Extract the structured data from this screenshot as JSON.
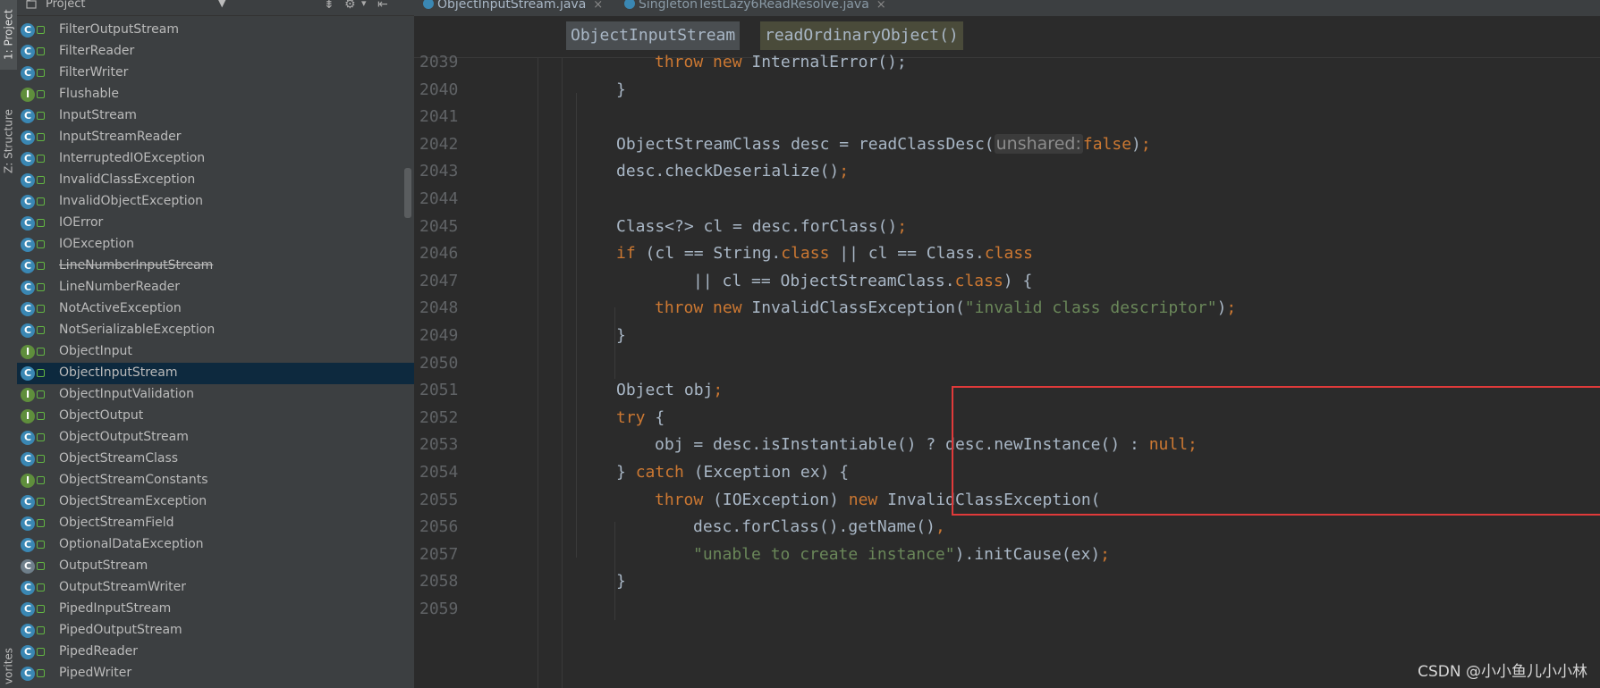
{
  "side_strip": {
    "project_tab": "1: Project",
    "structure_tab": "Z: Structure",
    "favorites_tab": "vorites"
  },
  "project_panel": {
    "title": "Project",
    "selected": "ObjectInputStream",
    "items": [
      {
        "name": "FilterOutputStream",
        "kind": "class"
      },
      {
        "name": "FilterReader",
        "kind": "class"
      },
      {
        "name": "FilterWriter",
        "kind": "class"
      },
      {
        "name": "Flushable",
        "kind": "interface"
      },
      {
        "name": "InputStream",
        "kind": "class"
      },
      {
        "name": "InputStreamReader",
        "kind": "class"
      },
      {
        "name": "InterruptedIOException",
        "kind": "class"
      },
      {
        "name": "InvalidClassException",
        "kind": "class"
      },
      {
        "name": "InvalidObjectException",
        "kind": "class"
      },
      {
        "name": "IOError",
        "kind": "class"
      },
      {
        "name": "IOException",
        "kind": "class"
      },
      {
        "name": "LineNumberInputStream",
        "kind": "class",
        "deprecated": true
      },
      {
        "name": "LineNumberReader",
        "kind": "class"
      },
      {
        "name": "NotActiveException",
        "kind": "class"
      },
      {
        "name": "NotSerializableException",
        "kind": "class"
      },
      {
        "name": "ObjectInput",
        "kind": "interface"
      },
      {
        "name": "ObjectInputStream",
        "kind": "class"
      },
      {
        "name": "ObjectInputValidation",
        "kind": "interface"
      },
      {
        "name": "ObjectOutput",
        "kind": "interface"
      },
      {
        "name": "ObjectOutputStream",
        "kind": "class"
      },
      {
        "name": "ObjectStreamClass",
        "kind": "class"
      },
      {
        "name": "ObjectStreamConstants",
        "kind": "interface"
      },
      {
        "name": "ObjectStreamException",
        "kind": "class"
      },
      {
        "name": "ObjectStreamField",
        "kind": "class"
      },
      {
        "name": "OptionalDataException",
        "kind": "class"
      },
      {
        "name": "OutputStream",
        "kind": "abstract"
      },
      {
        "name": "OutputStreamWriter",
        "kind": "class"
      },
      {
        "name": "PipedInputStream",
        "kind": "class"
      },
      {
        "name": "PipedOutputStream",
        "kind": "class"
      },
      {
        "name": "PipedReader",
        "kind": "class"
      },
      {
        "name": "PipedWriter",
        "kind": "class"
      }
    ]
  },
  "editor": {
    "tabs": [
      {
        "label": "ObjectInputStream.java",
        "active": true
      },
      {
        "label": "SingletonTestLazy6ReadResolve.java",
        "active": false
      }
    ],
    "breadcrumb": [
      "ObjectInputStream",
      "readOrdinaryObject()"
    ],
    "lines": [
      {
        "no": "2039",
        "indent": 2,
        "parts": [
          {
            "t": "throw new ",
            "c": "kw"
          },
          {
            "t": "InternalError();"
          }
        ]
      },
      {
        "no": "2040",
        "indent": 1,
        "parts": [
          {
            "t": "}"
          }
        ]
      },
      {
        "no": "2041",
        "indent": 0,
        "parts": []
      },
      {
        "no": "2042",
        "indent": 1,
        "parts": [
          {
            "t": "ObjectStreamClass desc = readClassDesc("
          },
          {
            "t": "unshared:",
            "c": "hint"
          },
          {
            "t": "false",
            "c": "kw"
          },
          {
            "t": ")"
          },
          {
            "t": ";",
            "c": "kw"
          }
        ]
      },
      {
        "no": "2043",
        "indent": 1,
        "parts": [
          {
            "t": "desc.checkDeserialize()"
          },
          {
            "t": ";",
            "c": "kw"
          }
        ]
      },
      {
        "no": "2044",
        "indent": 0,
        "parts": []
      },
      {
        "no": "2045",
        "indent": 1,
        "parts": [
          {
            "t": "Class<?> cl = desc.forClass()"
          },
          {
            "t": ";",
            "c": "kw"
          }
        ]
      },
      {
        "no": "2046",
        "indent": 1,
        "parts": [
          {
            "t": "if ",
            "c": "kw"
          },
          {
            "t": "(cl == String."
          },
          {
            "t": "class",
            "c": "kw"
          },
          {
            "t": " || cl == Class."
          },
          {
            "t": "class",
            "c": "kw"
          }
        ]
      },
      {
        "no": "2047",
        "indent": 3,
        "parts": [
          {
            "t": "|| cl == ObjectStreamClass."
          },
          {
            "t": "class",
            "c": "kw"
          },
          {
            "t": ") {"
          }
        ]
      },
      {
        "no": "2048",
        "indent": 2,
        "parts": [
          {
            "t": "throw new ",
            "c": "kw"
          },
          {
            "t": "InvalidClassException("
          },
          {
            "t": "\"invalid class descriptor\"",
            "c": "str"
          },
          {
            "t": ")"
          },
          {
            "t": ";",
            "c": "kw"
          }
        ]
      },
      {
        "no": "2049",
        "indent": 1,
        "parts": [
          {
            "t": "}"
          }
        ]
      },
      {
        "no": "2050",
        "indent": 0,
        "parts": []
      },
      {
        "no": "2051",
        "indent": 1,
        "parts": [
          {
            "t": "Object obj"
          },
          {
            "t": ";",
            "c": "kw"
          }
        ]
      },
      {
        "no": "2052",
        "indent": 1,
        "parts": [
          {
            "t": "try ",
            "c": "kw"
          },
          {
            "t": "{"
          }
        ]
      },
      {
        "no": "2053",
        "indent": 2,
        "parts": [
          {
            "t": "obj = desc.isInstantiable() ? desc.newInstance() : "
          },
          {
            "t": "null;",
            "c": "kw"
          }
        ]
      },
      {
        "no": "2054",
        "indent": 1,
        "parts": [
          {
            "t": "} "
          },
          {
            "t": "catch ",
            "c": "kw"
          },
          {
            "t": "(Exception ex) {"
          }
        ]
      },
      {
        "no": "2055",
        "indent": 2,
        "parts": [
          {
            "t": "throw ",
            "c": "kw"
          },
          {
            "t": "(IOException) "
          },
          {
            "t": "new ",
            "c": "kw"
          },
          {
            "t": "InvalidClassException("
          }
        ]
      },
      {
        "no": "2056",
        "indent": 3,
        "parts": [
          {
            "t": "desc.forClass().getName()"
          },
          {
            "t": ",",
            "c": "kw"
          }
        ]
      },
      {
        "no": "2057",
        "indent": 3,
        "parts": [
          {
            "t": "\"unable to create instance\"",
            "c": "str"
          },
          {
            "t": ").initCause(ex)"
          },
          {
            "t": ";",
            "c": "kw"
          }
        ]
      },
      {
        "no": "2058",
        "indent": 1,
        "parts": [
          {
            "t": "}"
          }
        ]
      },
      {
        "no": "2059",
        "indent": 0,
        "parts": []
      }
    ]
  },
  "watermark": "CSDN @小小鱼儿小小林",
  "colors": {
    "keyword": "#cc7832",
    "string": "#6a8759",
    "default_text": "#a9b7c6",
    "highlight_box": "#e03a3a",
    "selection": "#0d293e"
  }
}
